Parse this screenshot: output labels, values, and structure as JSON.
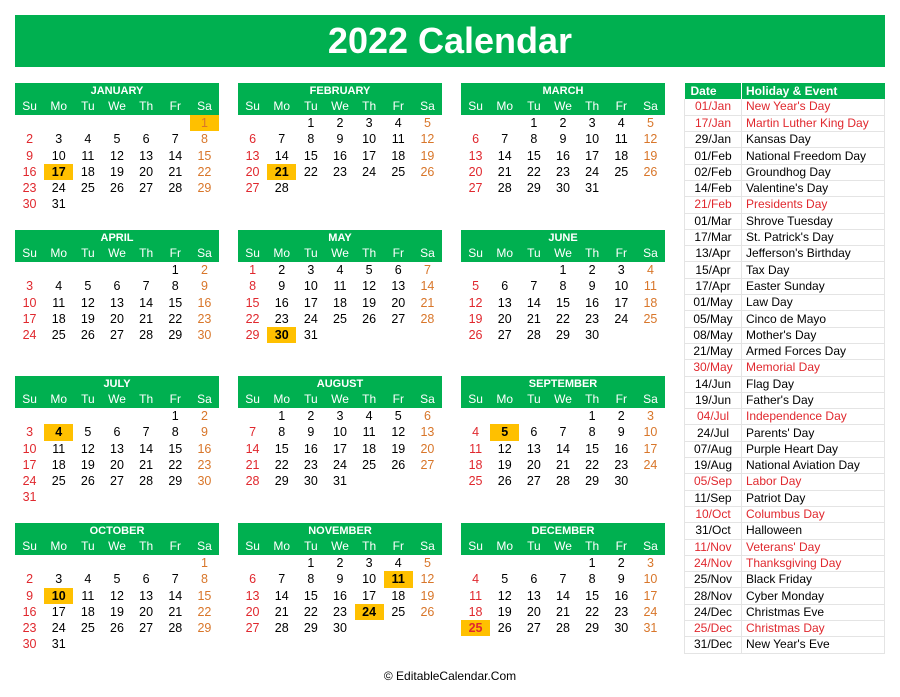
{
  "title": "2022 Calendar",
  "colors": {
    "accent": "#00b050",
    "highlight": "#ffc000",
    "sunday": "#e0282e",
    "saturday": "#d8762a",
    "holiday": "#e0282e"
  },
  "weekdays": [
    "Su",
    "Mo",
    "Tu",
    "We",
    "Th",
    "Fr",
    "Sa"
  ],
  "months": [
    {
      "name": "JANUARY",
      "start": 6,
      "days": 31,
      "highlights": [
        1,
        17
      ]
    },
    {
      "name": "FEBRUARY",
      "start": 2,
      "days": 28,
      "highlights": [
        21
      ]
    },
    {
      "name": "MARCH",
      "start": 2,
      "days": 31,
      "highlights": []
    },
    {
      "name": "APRIL",
      "start": 5,
      "days": 30,
      "highlights": []
    },
    {
      "name": "MAY",
      "start": 0,
      "days": 31,
      "highlights": [
        30
      ]
    },
    {
      "name": "JUNE",
      "start": 3,
      "days": 30,
      "highlights": []
    },
    {
      "name": "JULY",
      "start": 5,
      "days": 31,
      "highlights": [
        4
      ]
    },
    {
      "name": "AUGUST",
      "start": 1,
      "days": 31,
      "highlights": []
    },
    {
      "name": "SEPTEMBER",
      "start": 4,
      "days": 30,
      "highlights": [
        5
      ]
    },
    {
      "name": "OCTOBER",
      "start": 6,
      "days": 31,
      "highlights": [
        10
      ]
    },
    {
      "name": "NOVEMBER",
      "start": 2,
      "days": 30,
      "highlights": [
        11,
        24
      ]
    },
    {
      "name": "DECEMBER",
      "start": 4,
      "days": 31,
      "highlights": [
        25
      ]
    }
  ],
  "events": {
    "headers": {
      "date": "Date",
      "event": "Holiday & Event"
    },
    "rows": [
      {
        "date": "01/Jan",
        "name": "New Year's Day",
        "federal": true
      },
      {
        "date": "17/Jan",
        "name": "Martin Luther King Day",
        "federal": true
      },
      {
        "date": "29/Jan",
        "name": "Kansas Day",
        "federal": false
      },
      {
        "date": "01/Feb",
        "name": "National Freedom Day",
        "federal": false
      },
      {
        "date": "02/Feb",
        "name": "Groundhog Day",
        "federal": false
      },
      {
        "date": "14/Feb",
        "name": "Valentine's Day",
        "federal": false
      },
      {
        "date": "21/Feb",
        "name": "Presidents Day",
        "federal": true
      },
      {
        "date": "01/Mar",
        "name": "Shrove Tuesday",
        "federal": false
      },
      {
        "date": "17/Mar",
        "name": "St. Patrick's Day",
        "federal": false
      },
      {
        "date": "13/Apr",
        "name": "Jefferson's Birthday",
        "federal": false
      },
      {
        "date": "15/Apr",
        "name": "Tax Day",
        "federal": false
      },
      {
        "date": "17/Apr",
        "name": "Easter Sunday",
        "federal": false
      },
      {
        "date": "01/May",
        "name": "Law Day",
        "federal": false
      },
      {
        "date": "05/May",
        "name": "Cinco de Mayo",
        "federal": false
      },
      {
        "date": "08/May",
        "name": "Mother's Day",
        "federal": false
      },
      {
        "date": "21/May",
        "name": "Armed Forces Day",
        "federal": false
      },
      {
        "date": "30/May",
        "name": "Memorial Day",
        "federal": true
      },
      {
        "date": "14/Jun",
        "name": "Flag Day",
        "federal": false
      },
      {
        "date": "19/Jun",
        "name": "Father's Day",
        "federal": false
      },
      {
        "date": "04/Jul",
        "name": "Independence Day",
        "federal": true
      },
      {
        "date": "24/Jul",
        "name": "Parents' Day",
        "federal": false
      },
      {
        "date": "07/Aug",
        "name": "Purple Heart Day",
        "federal": false
      },
      {
        "date": "19/Aug",
        "name": "National Aviation Day",
        "federal": false
      },
      {
        "date": "05/Sep",
        "name": "Labor Day",
        "federal": true
      },
      {
        "date": "11/Sep",
        "name": "Patriot Day",
        "federal": false
      },
      {
        "date": "10/Oct",
        "name": "Columbus Day",
        "federal": true
      },
      {
        "date": "31/Oct",
        "name": "Halloween",
        "federal": false
      },
      {
        "date": "11/Nov",
        "name": "Veterans' Day",
        "federal": true
      },
      {
        "date": "24/Nov",
        "name": "Thanksgiving Day",
        "federal": true
      },
      {
        "date": "25/Nov",
        "name": "Black Friday",
        "federal": false
      },
      {
        "date": "28/Nov",
        "name": "Cyber Monday",
        "federal": false
      },
      {
        "date": "24/Dec",
        "name": "Christmas Eve",
        "federal": false
      },
      {
        "date": "25/Dec",
        "name": "Christmas Day",
        "federal": true
      },
      {
        "date": "31/Dec",
        "name": "New Year's Eve",
        "federal": false
      }
    ]
  },
  "footer": "© EditableCalendar.Com"
}
